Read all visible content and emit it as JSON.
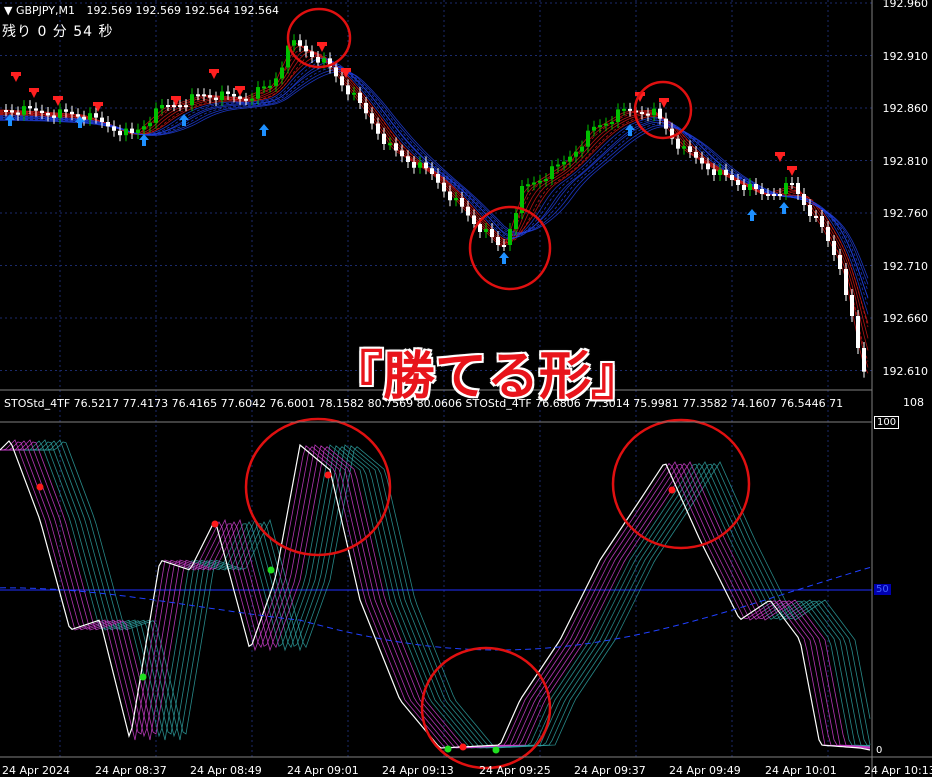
{
  "price_panel": {
    "symbol": "GBPJPY,M1",
    "ohlc": "192.569 192.569 192.564 192.564",
    "countdown": "残り 0 分 54 秒",
    "price_scale": [
      "192.960",
      "192.910",
      "192.860",
      "192.810",
      "192.760",
      "192.710",
      "192.660",
      "192.610"
    ]
  },
  "indicator_panel": {
    "header": "STOStd_4TF 76.5217 77.4173 76.4165 77.6042 76.6001 78.1582 80.7569 80.0606 STOStd_4TF 76.6806 77.3014 75.9981 77.3582 74.1607 76.5446 71",
    "scale_top": "108",
    "scale_100": "100",
    "scale_50": "50",
    "scale_0": "0"
  },
  "time_axis": [
    "24 Apr 2024",
    "24 Apr 08:37",
    "24 Apr 08:49",
    "24 Apr 09:01",
    "24 Apr 09:13",
    "24 Apr 09:25",
    "24 Apr 09:37",
    "24 Apr 09:49",
    "24 Apr 10:01",
    "24 Apr 10:13"
  ],
  "banner": "『勝てる形』",
  "colors": {
    "bull": "#00c000",
    "bear": "#ffffff",
    "down_arrow": "#ff2020",
    "up_arrow": "#1e90ff",
    "grid": "#1b2a6b",
    "circle": "#e01010",
    "stoch_main": "#ffffff",
    "stoch_magenta": "#d040d0",
    "stoch_teal": "#2ea0a0"
  }
}
